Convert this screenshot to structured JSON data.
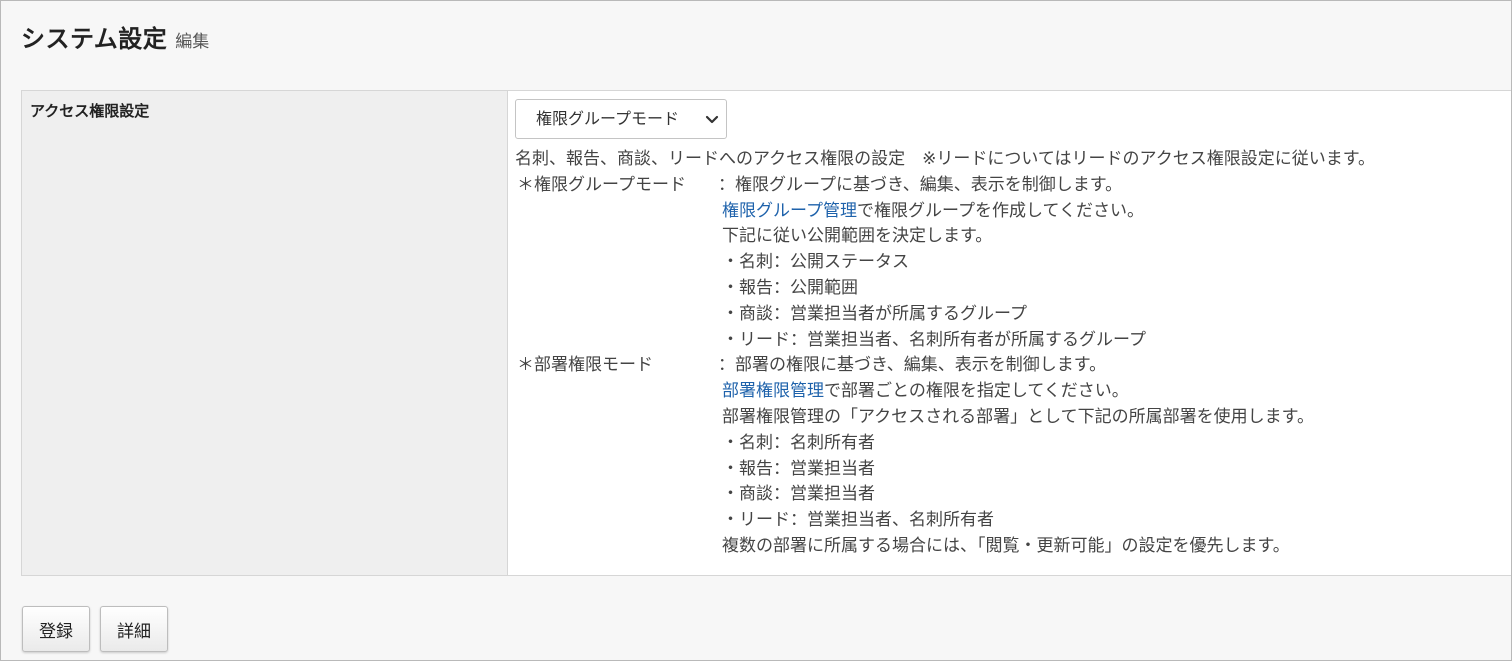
{
  "header": {
    "title": "システム設定",
    "subtitle": "編集"
  },
  "setting": {
    "label": "アクセス権限設定",
    "select": {
      "selected": "権限グループモード",
      "icon": "chevron-down-icon"
    },
    "intro": "名刺、報告、商談、リードへのアクセス権限の設定　※リードについてはリードのアクセス権限設定に従います。",
    "group_mode": {
      "term": "＊権限グループモード",
      "desc1": "：権限グループに基づき、編集、表示を制御します。",
      "link": "権限グループ管理",
      "link_suffix": "で権限グループを作成してください。",
      "desc2": "下記に従い公開範囲を決定します。",
      "items": [
        "・名刺：公開ステータス",
        "・報告：公開範囲",
        "・商談：営業担当者が所属するグループ",
        "・リード：営業担当者、名刺所有者が所属するグループ"
      ]
    },
    "dept_mode": {
      "term": "＊部署権限モード",
      "desc1": "：部署の権限に基づき、編集、表示を制御します。",
      "link": "部署権限管理",
      "link_suffix": "で部署ごとの権限を指定してください。",
      "desc2": "部署権限管理の「アクセスされる部署」として下記の所属部署を使用します。",
      "items": [
        "・名刺：名刺所有者",
        "・報告：営業担当者",
        "・商談：営業担当者",
        "・リード：営業担当者、名刺所有者"
      ],
      "footer": "複数の部署に所属する場合には、「閲覧・更新可能」の設定を優先します。"
    }
  },
  "buttons": {
    "register": "登録",
    "detail": "詳細"
  },
  "colors": {
    "link": "#1e62ab",
    "label_bg": "#efefef",
    "page_bg": "#f7f7f7"
  }
}
